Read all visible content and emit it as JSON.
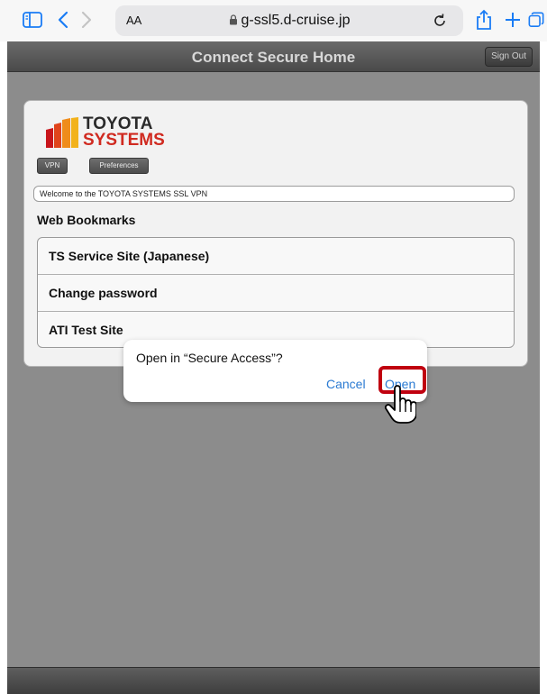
{
  "safari": {
    "text_size_label": "AA",
    "url": "g-ssl5.d-cruise.jp",
    "icons": [
      "sidebar-icon",
      "back-icon",
      "forward-icon",
      "lock-icon",
      "reload-icon",
      "share-icon",
      "new-tab-icon",
      "tabs-icon"
    ]
  },
  "header": {
    "title": "Connect Secure Home",
    "sign_out": "Sign Out"
  },
  "logo": {
    "line1": "TOYOTA",
    "line2": "SYSTEMS"
  },
  "nav": {
    "vpn": "VPN",
    "preferences": "Preferences"
  },
  "welcome": "Welcome to the TOYOTA SYSTEMS SSL VPN",
  "web_bookmarks": {
    "title": "Web Bookmarks",
    "items": [
      "TS Service Site (Japanese)",
      "Change password",
      "ATI Test Site"
    ]
  },
  "dialog": {
    "message": "Open in “Secure Access”?",
    "cancel": "Cancel",
    "open": "Open"
  },
  "colors": {
    "accent_link": "#2a7ad2",
    "highlight": "#c0000f",
    "brand_red": "#d02a20"
  }
}
